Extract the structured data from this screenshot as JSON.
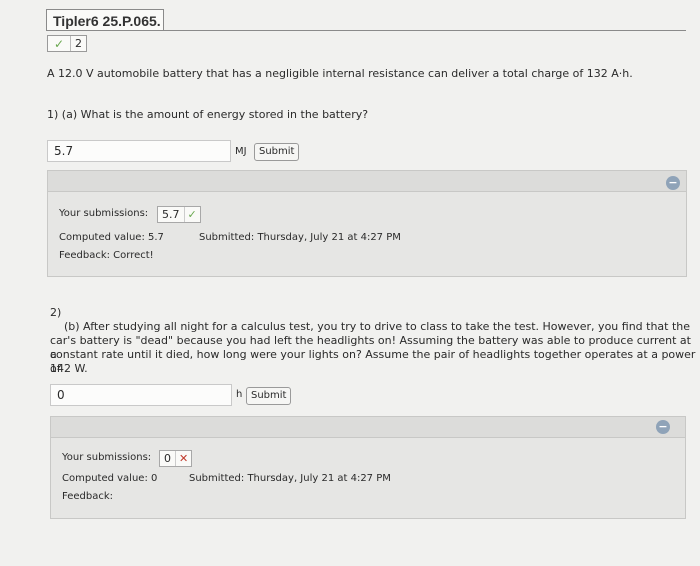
{
  "header": {
    "title": "Tipler6 25.P.065.",
    "score": "2"
  },
  "problem": {
    "statement": "A 12.0 V automobile battery that has a negligible internal resistance can deliver a total charge of 132 A·h."
  },
  "part1": {
    "question": "1) (a) What is the amount of energy stored in the battery?",
    "input_value": "5.7",
    "unit": "MJ",
    "submit_label": "Submit",
    "collapse_symbol": "−",
    "submissions_label": "Your submissions:",
    "submission_value": "5.7",
    "computed_label": "Computed value: 5.7",
    "submitted_label": "Submitted: Thursday, July 21 at 4:27 PM",
    "feedback_label": "Feedback: Correct!"
  },
  "part2": {
    "number": "2)",
    "question_lines": [
      "(b) After studying all night for a calculus test, you try to drive to class to take the test. However, you find that the",
      "car's battery is \"dead\" because you had left the headlights on! Assuming the battery was able to produce current at a",
      "constant rate until it died, how long were your lights on? Assume the pair of headlights together operates at a power of",
      "142 W."
    ],
    "input_value": "0",
    "unit": "h",
    "submit_label": "Submit",
    "collapse_symbol": "−",
    "submissions_label": "Your submissions:",
    "submission_value": "0",
    "computed_label": "Computed value: 0",
    "submitted_label": "Submitted: Thursday, July 21 at 4:27 PM",
    "feedback_label": "Feedback:"
  }
}
